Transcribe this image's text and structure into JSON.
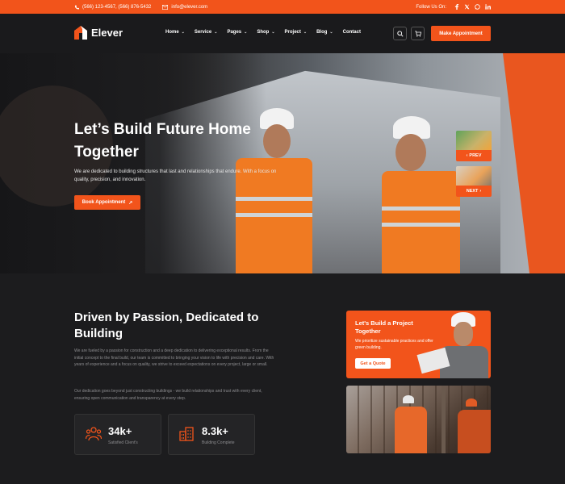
{
  "topbar": {
    "phone": "(566) 123-4567,  (566) 876-5432",
    "email": "info@elever.com",
    "follow_label": "Follow Us On:",
    "socials": [
      "facebook-icon",
      "twitter-icon",
      "whatsapp-icon",
      "linkedin-icon"
    ]
  },
  "header": {
    "logo_text": "Elever",
    "nav": [
      {
        "label": "Home",
        "dropdown": true
      },
      {
        "label": "Service",
        "dropdown": true
      },
      {
        "label": "Pages",
        "dropdown": true
      },
      {
        "label": "Shop",
        "dropdown": true
      },
      {
        "label": "Project",
        "dropdown": true
      },
      {
        "label": "Blog",
        "dropdown": true
      },
      {
        "label": "Contact",
        "dropdown": false
      }
    ],
    "cta_label": "Make Appointment"
  },
  "hero": {
    "title": "Let’s Build Future Home Together",
    "subtitle": "We are dedicated to building structures that last and relationships that endure. With a focus on quality, precision, and innovation.",
    "button_label": "Book Appointment",
    "prev_label": "PREV",
    "next_label": "NEXT"
  },
  "about": {
    "title": "Driven by Passion, Dedicated to Building",
    "para1": "We are fueled by a passion for construction and a deep dedication to delivering exceptional results. From the initial concept to the final build, our team is committed to bringing your vision to life with precision and care. With years of experience and a focus on quality, we strive to exceed expectations on every project, large or small.",
    "para2": "Our dedication goes beyond just constructing buildings - we build relationships and trust with every client, ensuring open communication and transparency at every step.",
    "stats": [
      {
        "value": "34k+",
        "label": "Satisfied Client's"
      },
      {
        "value": "8.3k+",
        "label": "Building Complete"
      }
    ]
  },
  "promo": {
    "title": "Let's Build a Project Together",
    "subtitle": "We prioritize sustainable practices and offer green building.",
    "button_label": "Get a Quote"
  },
  "colors": {
    "accent": "#f2541b",
    "background": "#1b1b1d"
  }
}
